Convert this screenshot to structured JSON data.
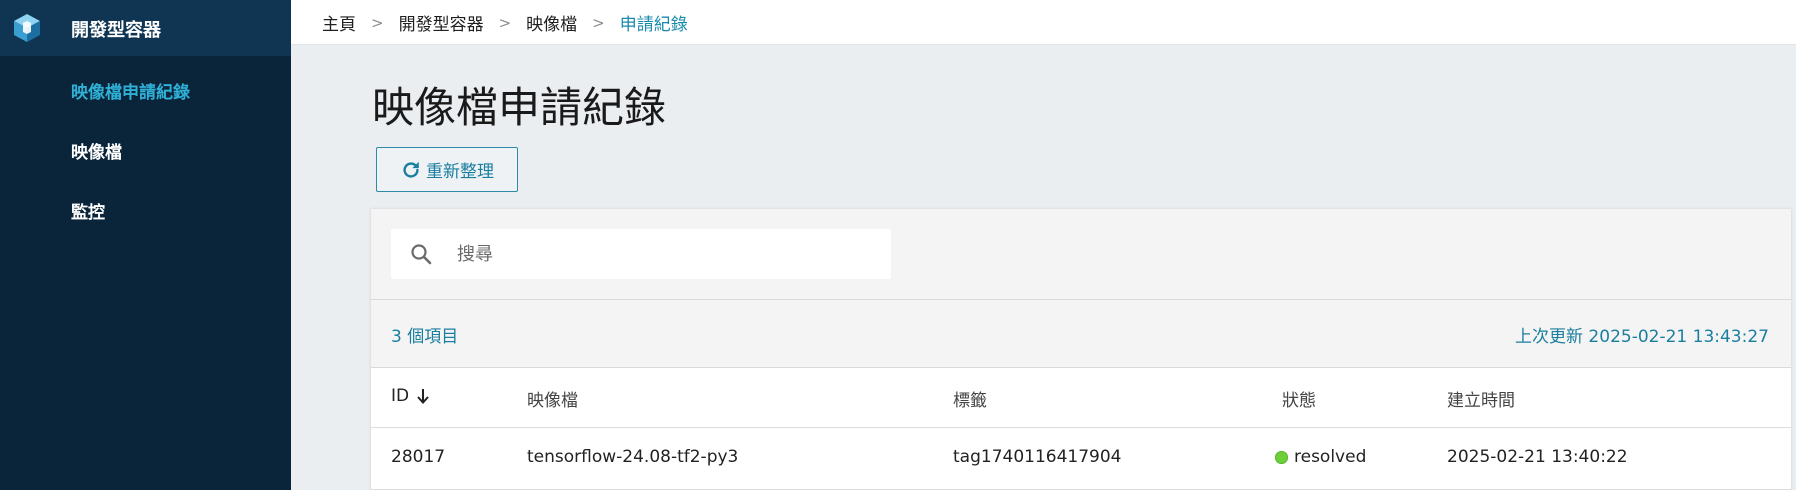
{
  "sidebar": {
    "title": "開發型容器",
    "items": [
      {
        "label": "映像檔申請紀錄"
      },
      {
        "label": "映像檔"
      },
      {
        "label": "監控"
      }
    ]
  },
  "breadcrumb": {
    "items": [
      "主頁",
      "開發型容器",
      "映像檔",
      "申請紀錄"
    ],
    "separator": ">"
  },
  "page": {
    "title": "映像檔申請紀錄",
    "refresh_label": "重新整理"
  },
  "search": {
    "placeholder": "搜尋",
    "value": ""
  },
  "summary": {
    "item_count": "3 個項目",
    "last_updated": "上次更新 2025-02-21 13:43:27"
  },
  "table": {
    "columns": [
      "ID",
      "映像檔",
      "標籤",
      "狀態",
      "建立時間"
    ],
    "rows": [
      {
        "id": "28017",
        "image": "tensorflow-24.08-tf2-py3",
        "tag": "tag1740116417904",
        "status": "resolved",
        "created": "2025-02-21 13:40:22"
      }
    ]
  },
  "colors": {
    "sidebar_bg": "#0a243a",
    "accent": "#1a7e9f",
    "active_nav": "#2fb0d6",
    "status_resolved": "#6fcf3a"
  },
  "icons": {
    "logo": "cube-logo-icon",
    "refresh": "refresh-icon",
    "search": "search-icon",
    "sort": "arrow-down-icon"
  }
}
